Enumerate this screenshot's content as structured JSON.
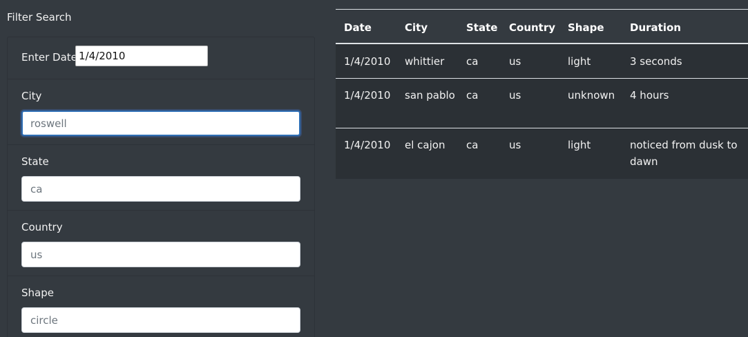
{
  "filter": {
    "title": "Filter Search",
    "date": {
      "label": "Enter Date",
      "value": "1/4/2010"
    },
    "city": {
      "label": "City",
      "placeholder": "roswell"
    },
    "state": {
      "label": "State",
      "placeholder": "ca"
    },
    "country": {
      "label": "Country",
      "placeholder": "us"
    },
    "shape": {
      "label": "Shape",
      "placeholder": "circle"
    }
  },
  "table": {
    "headers": [
      "Date",
      "City",
      "State",
      "Country",
      "Shape",
      "Duration"
    ],
    "rows": [
      {
        "date": "1/4/2010",
        "city": "whittier",
        "state": "ca",
        "country": "us",
        "shape": "light",
        "duration": "3 seconds"
      },
      {
        "date": "1/4/2010",
        "city": "san pablo",
        "state": "ca",
        "country": "us",
        "shape": "unknown",
        "duration": "4 hours"
      },
      {
        "date": "1/4/2010",
        "city": "el cajon",
        "state": "ca",
        "country": "us",
        "shape": "light",
        "duration": "noticed from dusk to dawn"
      }
    ]
  },
  "colors": {
    "page_background": "#343a40",
    "focus_border": "#2f6fb5"
  }
}
